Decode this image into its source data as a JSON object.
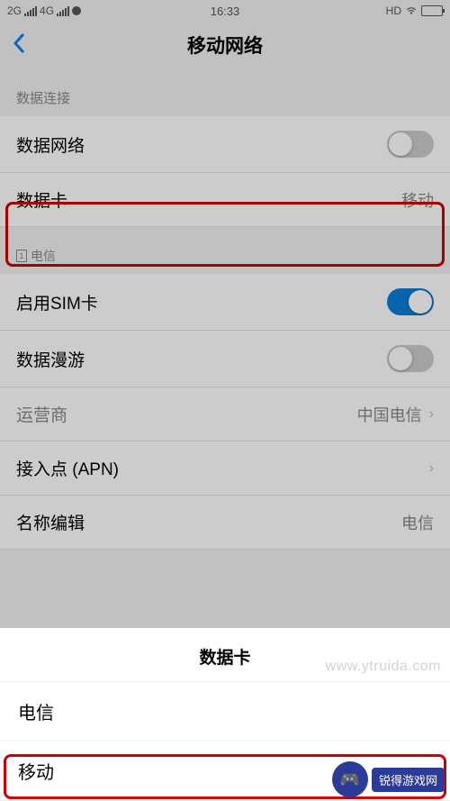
{
  "status": {
    "net2g": "2G",
    "net4g": "4G",
    "time": "16:33",
    "hd": "HD"
  },
  "nav": {
    "title": "移动网络"
  },
  "section1": {
    "header": "数据连接",
    "data_network": "数据网络",
    "data_card": "数据卡",
    "data_card_value": "移动"
  },
  "section2": {
    "sim_badge": "1",
    "header": "电信",
    "enable_sim": "启用SIM卡",
    "data_roaming": "数据漫游",
    "carrier": "运营商",
    "carrier_value": "中国电信",
    "apn": "接入点 (APN)",
    "name_edit": "名称编辑",
    "name_edit_value": "电信"
  },
  "sheet": {
    "title": "数据卡",
    "options": [
      "电信",
      "移动"
    ]
  },
  "watermark": {
    "site": "锐得游戏网",
    "url": "www.ytruida.com"
  }
}
